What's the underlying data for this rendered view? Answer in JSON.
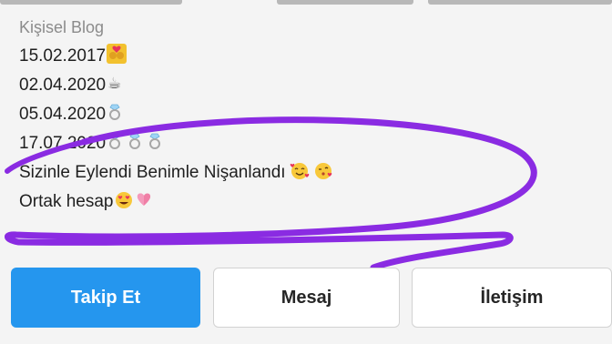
{
  "profile": {
    "category": "Kişisel Blog",
    "bio_lines": [
      {
        "text": "15.02.2017",
        "emoji": "couple-with-heart-icon"
      },
      {
        "text": "02.04.2020",
        "emoji": "coffee-icon"
      },
      {
        "text": "05.04.2020",
        "emoji": "ring-icon"
      },
      {
        "text": "17.07.2020",
        "emoji": "ring-icon x3"
      },
      {
        "text": "Sizinle Eylendi Benimle Nişanlandı",
        "emoji": "smiling-face-with-hearts-icon, face-blowing-kiss-icon"
      },
      {
        "text": "Ortak hesap",
        "emoji": "heart-eyes-icon, sparkling-heart-icon"
      }
    ]
  },
  "annotation": {
    "color": "#8a2be2",
    "icon": "purple-marker-circle"
  },
  "actions": {
    "follow_label": "Takip Et",
    "message_label": "Mesaj",
    "contact_label": "İletişim",
    "follow_color": "#2596ee"
  }
}
